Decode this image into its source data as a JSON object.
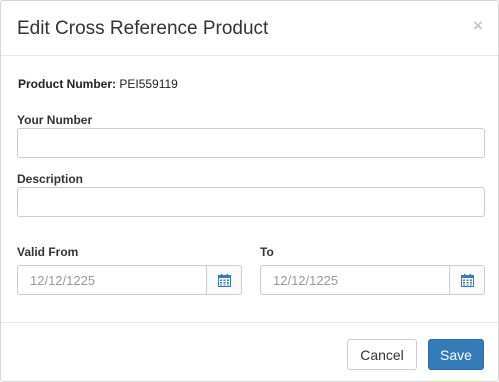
{
  "dialog": {
    "title": "Edit Cross Reference Product",
    "close_glyph": "×"
  },
  "product": {
    "label": "Product Number:",
    "value": "PEI559119"
  },
  "form": {
    "your_number": {
      "label": "Your Number",
      "value": "",
      "placeholder": ""
    },
    "description": {
      "label": "Description",
      "value": "",
      "placeholder": ""
    },
    "valid_from": {
      "label": "Valid From",
      "placeholder": "12/12/1225",
      "icon": "calendar-icon"
    },
    "valid_to": {
      "label": "To",
      "placeholder": "12/12/1225",
      "icon": "calendar-icon"
    }
  },
  "footer": {
    "cancel_label": "Cancel",
    "save_label": "Save"
  },
  "colors": {
    "primary": "#337ab7",
    "calendar_icon": "#3a7ab8",
    "close_icon": "#c7c7c7"
  }
}
